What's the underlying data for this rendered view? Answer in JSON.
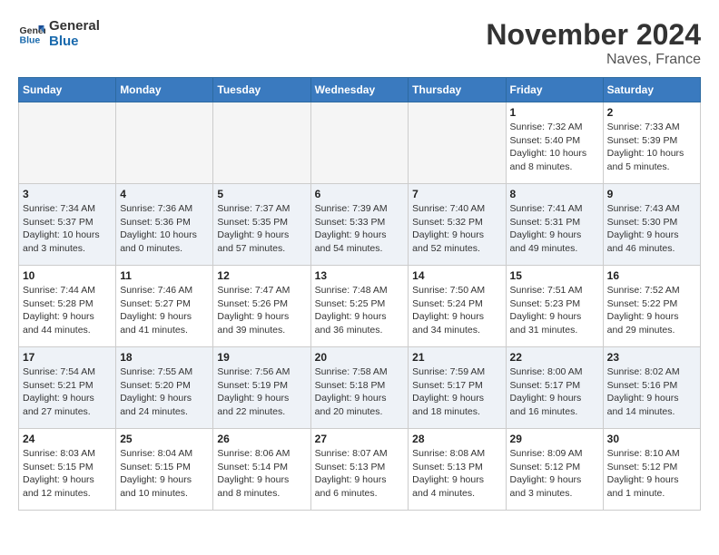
{
  "logo": {
    "line1": "General",
    "line2": "Blue"
  },
  "title": "November 2024",
  "location": "Naves, France",
  "weekdays": [
    "Sunday",
    "Monday",
    "Tuesday",
    "Wednesday",
    "Thursday",
    "Friday",
    "Saturday"
  ],
  "weeks": [
    [
      {
        "day": "",
        "info": ""
      },
      {
        "day": "",
        "info": ""
      },
      {
        "day": "",
        "info": ""
      },
      {
        "day": "",
        "info": ""
      },
      {
        "day": "",
        "info": ""
      },
      {
        "day": "1",
        "info": "Sunrise: 7:32 AM\nSunset: 5:40 PM\nDaylight: 10 hours\nand 8 minutes."
      },
      {
        "day": "2",
        "info": "Sunrise: 7:33 AM\nSunset: 5:39 PM\nDaylight: 10 hours\nand 5 minutes."
      }
    ],
    [
      {
        "day": "3",
        "info": "Sunrise: 7:34 AM\nSunset: 5:37 PM\nDaylight: 10 hours\nand 3 minutes."
      },
      {
        "day": "4",
        "info": "Sunrise: 7:36 AM\nSunset: 5:36 PM\nDaylight: 10 hours\nand 0 minutes."
      },
      {
        "day": "5",
        "info": "Sunrise: 7:37 AM\nSunset: 5:35 PM\nDaylight: 9 hours\nand 57 minutes."
      },
      {
        "day": "6",
        "info": "Sunrise: 7:39 AM\nSunset: 5:33 PM\nDaylight: 9 hours\nand 54 minutes."
      },
      {
        "day": "7",
        "info": "Sunrise: 7:40 AM\nSunset: 5:32 PM\nDaylight: 9 hours\nand 52 minutes."
      },
      {
        "day": "8",
        "info": "Sunrise: 7:41 AM\nSunset: 5:31 PM\nDaylight: 9 hours\nand 49 minutes."
      },
      {
        "day": "9",
        "info": "Sunrise: 7:43 AM\nSunset: 5:30 PM\nDaylight: 9 hours\nand 46 minutes."
      }
    ],
    [
      {
        "day": "10",
        "info": "Sunrise: 7:44 AM\nSunset: 5:28 PM\nDaylight: 9 hours\nand 44 minutes."
      },
      {
        "day": "11",
        "info": "Sunrise: 7:46 AM\nSunset: 5:27 PM\nDaylight: 9 hours\nand 41 minutes."
      },
      {
        "day": "12",
        "info": "Sunrise: 7:47 AM\nSunset: 5:26 PM\nDaylight: 9 hours\nand 39 minutes."
      },
      {
        "day": "13",
        "info": "Sunrise: 7:48 AM\nSunset: 5:25 PM\nDaylight: 9 hours\nand 36 minutes."
      },
      {
        "day": "14",
        "info": "Sunrise: 7:50 AM\nSunset: 5:24 PM\nDaylight: 9 hours\nand 34 minutes."
      },
      {
        "day": "15",
        "info": "Sunrise: 7:51 AM\nSunset: 5:23 PM\nDaylight: 9 hours\nand 31 minutes."
      },
      {
        "day": "16",
        "info": "Sunrise: 7:52 AM\nSunset: 5:22 PM\nDaylight: 9 hours\nand 29 minutes."
      }
    ],
    [
      {
        "day": "17",
        "info": "Sunrise: 7:54 AM\nSunset: 5:21 PM\nDaylight: 9 hours\nand 27 minutes."
      },
      {
        "day": "18",
        "info": "Sunrise: 7:55 AM\nSunset: 5:20 PM\nDaylight: 9 hours\nand 24 minutes."
      },
      {
        "day": "19",
        "info": "Sunrise: 7:56 AM\nSunset: 5:19 PM\nDaylight: 9 hours\nand 22 minutes."
      },
      {
        "day": "20",
        "info": "Sunrise: 7:58 AM\nSunset: 5:18 PM\nDaylight: 9 hours\nand 20 minutes."
      },
      {
        "day": "21",
        "info": "Sunrise: 7:59 AM\nSunset: 5:17 PM\nDaylight: 9 hours\nand 18 minutes."
      },
      {
        "day": "22",
        "info": "Sunrise: 8:00 AM\nSunset: 5:17 PM\nDaylight: 9 hours\nand 16 minutes."
      },
      {
        "day": "23",
        "info": "Sunrise: 8:02 AM\nSunset: 5:16 PM\nDaylight: 9 hours\nand 14 minutes."
      }
    ],
    [
      {
        "day": "24",
        "info": "Sunrise: 8:03 AM\nSunset: 5:15 PM\nDaylight: 9 hours\nand 12 minutes."
      },
      {
        "day": "25",
        "info": "Sunrise: 8:04 AM\nSunset: 5:15 PM\nDaylight: 9 hours\nand 10 minutes."
      },
      {
        "day": "26",
        "info": "Sunrise: 8:06 AM\nSunset: 5:14 PM\nDaylight: 9 hours\nand 8 minutes."
      },
      {
        "day": "27",
        "info": "Sunrise: 8:07 AM\nSunset: 5:13 PM\nDaylight: 9 hours\nand 6 minutes."
      },
      {
        "day": "28",
        "info": "Sunrise: 8:08 AM\nSunset: 5:13 PM\nDaylight: 9 hours\nand 4 minutes."
      },
      {
        "day": "29",
        "info": "Sunrise: 8:09 AM\nSunset: 5:12 PM\nDaylight: 9 hours\nand 3 minutes."
      },
      {
        "day": "30",
        "info": "Sunrise: 8:10 AM\nSunset: 5:12 PM\nDaylight: 9 hours\nand 1 minute."
      }
    ]
  ]
}
